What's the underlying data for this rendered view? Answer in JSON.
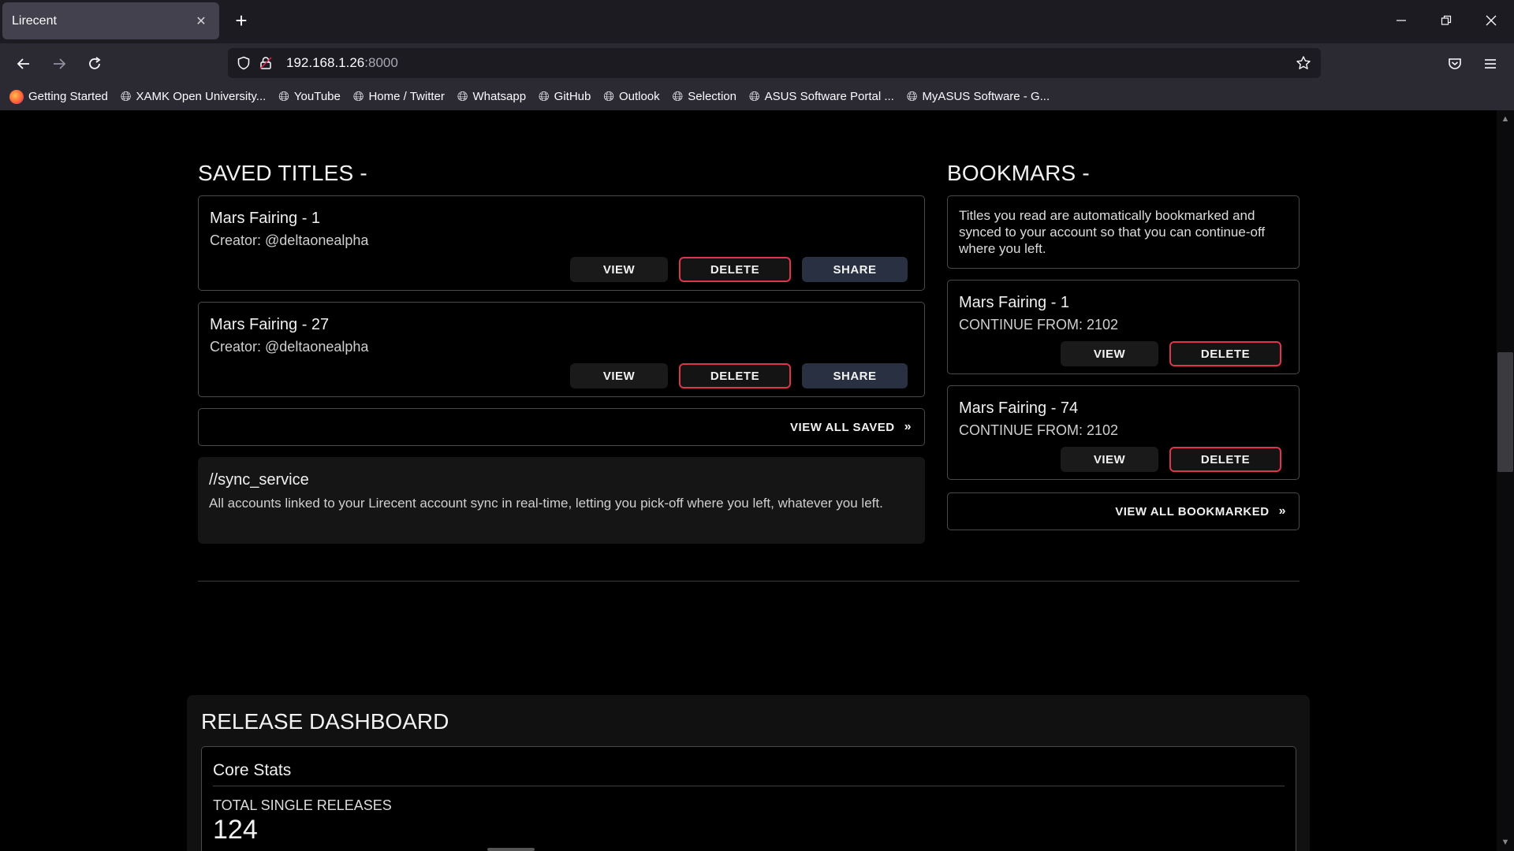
{
  "browser": {
    "tab_title": "Lirecent",
    "tab_close": "✕",
    "new_tab": "+",
    "url_host": "192.168.1.26",
    "url_port": ":8000",
    "bookmarks": [
      {
        "label": "Getting Started",
        "icon": "firefox-icon"
      },
      {
        "label": "XAMK Open University...",
        "icon": "globe-icon"
      },
      {
        "label": "YouTube",
        "icon": "globe-icon"
      },
      {
        "label": "Home / Twitter",
        "icon": "globe-icon"
      },
      {
        "label": "Whatsapp",
        "icon": "globe-icon"
      },
      {
        "label": "GitHub",
        "icon": "globe-icon"
      },
      {
        "label": "Outlook",
        "icon": "globe-icon"
      },
      {
        "label": "Selection",
        "icon": "globe-icon"
      },
      {
        "label": "ASUS Software Portal ...",
        "icon": "globe-icon"
      },
      {
        "label": "MyASUS Software - G...",
        "icon": "globe-icon"
      }
    ]
  },
  "saved": {
    "heading": "SAVED TITLES -",
    "items": [
      {
        "title": "Mars Fairing - 1",
        "creator": "Creator: @deltaonealpha",
        "view": "VIEW",
        "delete": "DELETE",
        "share": "SHARE"
      },
      {
        "title": "Mars Fairing - 27",
        "creator": "Creator: @deltaonealpha",
        "view": "VIEW",
        "delete": "DELETE",
        "share": "SHARE"
      }
    ],
    "view_all": "VIEW ALL SAVED",
    "chevron": "»"
  },
  "sync": {
    "title": "//sync_service",
    "text": "All accounts linked to your Lirecent account sync in real-time, letting you pick-off where you left, whatever you left."
  },
  "bookmarks_section": {
    "heading": "BOOKMARS -",
    "info": "Titles you read are automatically bookmarked and synced to your account so that you can continue-off where you left.",
    "items": [
      {
        "title": "Mars Fairing - 1",
        "continue": "CONTINUE FROM: 2102",
        "view": "VIEW",
        "delete": "DELETE"
      },
      {
        "title": "Mars Fairing - 74",
        "continue": "CONTINUE FROM: 2102",
        "view": "VIEW",
        "delete": "DELETE"
      }
    ],
    "view_all": "VIEW ALL BOOKMARKED",
    "chevron": "»"
  },
  "dashboard": {
    "title": "RELEASE DASHBOARD",
    "core_stats": "Core Stats",
    "total_label": "TOTAL SINGLE RELEASES",
    "total_value": "124"
  },
  "colors": {
    "accent_delete": "#e0344a",
    "share_bg": "#283041",
    "page_bg": "#000000"
  }
}
